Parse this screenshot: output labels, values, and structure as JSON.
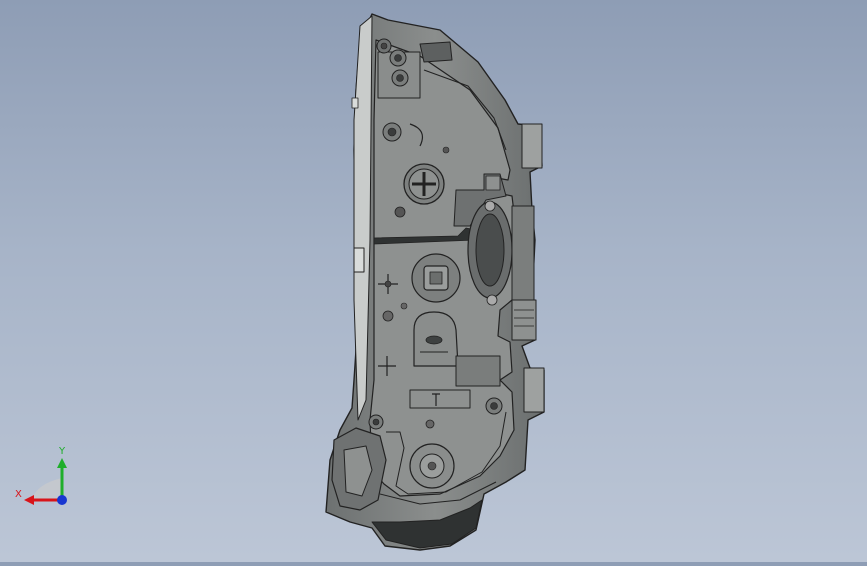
{
  "viewport": {
    "background_top": "#8e9db5",
    "background_bottom": "#bcc6d6"
  },
  "part": {
    "body_color": "#7f8383",
    "face_color": "#8a8d8c",
    "edge_color": "#2a2c2c",
    "shadow_color": "#3e4141"
  },
  "triad": {
    "x_label": "X",
    "y_label": "Y",
    "x_color": "#d8141a",
    "y_color": "#1fae2b",
    "z_color": "#1736d1",
    "icons": [
      "x-axis-arrow",
      "y-axis-arrow",
      "z-axis-dot"
    ]
  }
}
